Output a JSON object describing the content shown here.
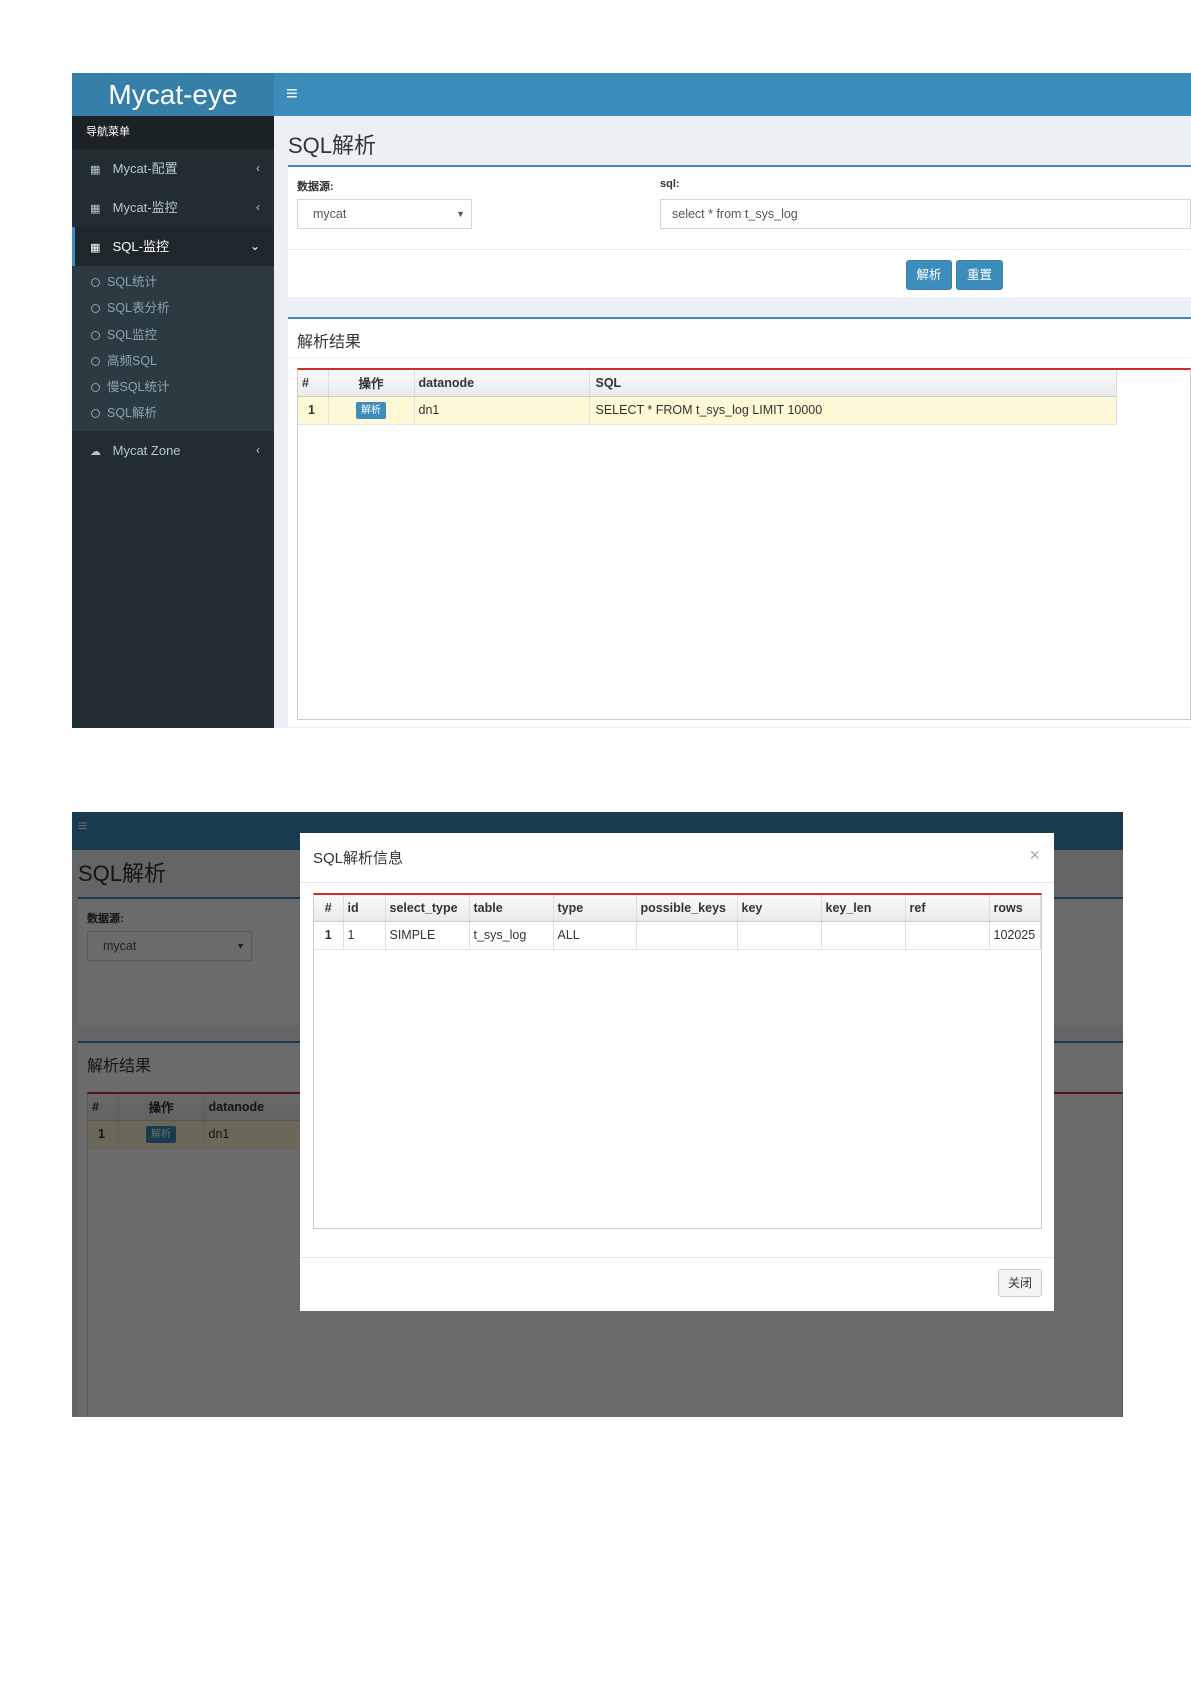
{
  "app": {
    "title": "Mycat-eye",
    "menu_toggle": "≡"
  },
  "sidebar": {
    "header": "导航菜单",
    "items": [
      {
        "label": "Mycat-配置",
        "icon": "grid-icon",
        "arrow": "‹"
      },
      {
        "label": "Mycat-监控",
        "icon": "grid-icon",
        "arrow": "‹"
      },
      {
        "label": "SQL-监控",
        "icon": "grid-icon",
        "arrow": "⌄",
        "active": true
      },
      {
        "label": "Mycat Zone",
        "icon": "cloud-icon",
        "arrow": "‹"
      }
    ],
    "subitems": [
      "SQL统计",
      "SQL表分析",
      "SQL监控",
      "高频SQL",
      "慢SQL统计",
      "SQL解析"
    ]
  },
  "page": {
    "title": "SQL解析"
  },
  "form": {
    "datasource_label": "数据源:",
    "datasource_value": "mycat",
    "sql_label": "sql:",
    "sql_value": "select * from t_sys_log",
    "parse_button": "解析",
    "reset_button": "重置"
  },
  "results": {
    "title": "解析结果",
    "columns": [
      "#",
      "操作",
      "datanode",
      "SQL"
    ],
    "rows": [
      {
        "index": "1",
        "action": "解析",
        "datanode": "dn1",
        "sql": "SELECT * FROM t_sys_log LIMIT 10000"
      }
    ]
  },
  "modal": {
    "title": "SQL解析信息",
    "close_icon": "×",
    "close_button": "关闭",
    "columns": [
      "#",
      "id",
      "select_type",
      "table",
      "type",
      "possible_keys",
      "key",
      "key_len",
      "ref",
      "rows"
    ],
    "rows": [
      {
        "index": "1",
        "id": "1",
        "select_type": "SIMPLE",
        "table": "t_sys_log",
        "type": "ALL",
        "possible_keys": "",
        "key": "",
        "key_len": "",
        "ref": "",
        "rows": "102025"
      }
    ]
  },
  "colors": {
    "header": "#3c8dbc",
    "logo": "#367fa9",
    "sidebar": "#222d32",
    "highlight_row": "#fff8d6",
    "table_accent": "#c9302c"
  }
}
